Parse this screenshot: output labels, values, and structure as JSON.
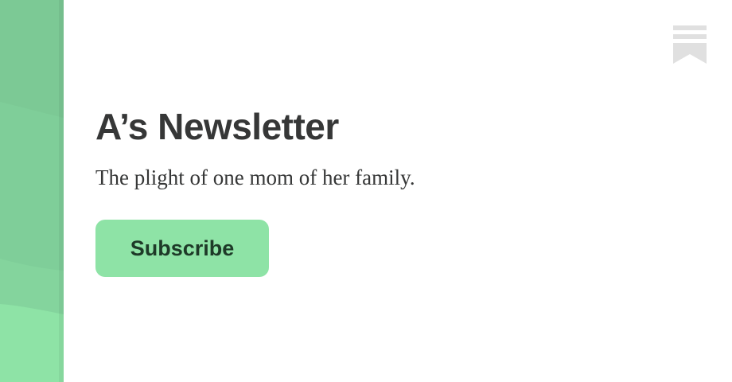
{
  "newsletter": {
    "title": "A’s Newsletter",
    "subtitle": "The plight of one mom of her family.",
    "subscribe_label": "Subscribe"
  },
  "icons": {
    "brand": "bookmark-logo-icon"
  },
  "colors": {
    "side_panel_dark": "#7cc995",
    "side_panel_mid": "#84d49d",
    "side_panel_light": "#8ee3a6",
    "button_bg": "#8ee3a6",
    "button_text": "#1e3a28",
    "heading_text": "#363737",
    "icon_gray": "#e0e0e0"
  }
}
